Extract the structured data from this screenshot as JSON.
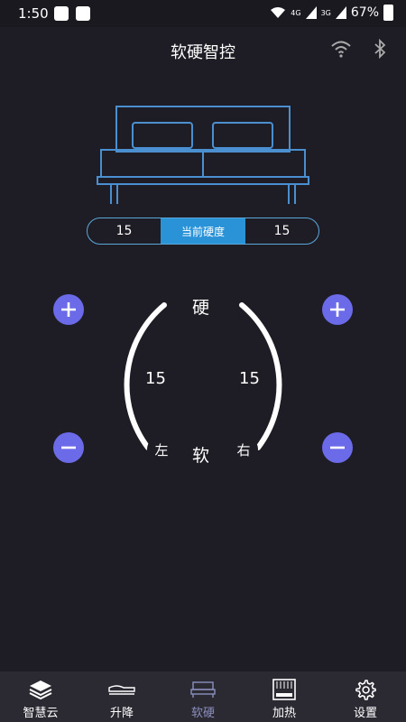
{
  "status_bar": {
    "time": "1:50",
    "battery_percent": "67%",
    "network_labels": [
      "4G",
      "3G"
    ]
  },
  "header": {
    "title": "软硬智控"
  },
  "hardness": {
    "left_value": "15",
    "label": "当前硬度",
    "right_value": "15"
  },
  "dial": {
    "top_label": "硬",
    "bottom_label": "软",
    "left_value": "15",
    "right_value": "15",
    "left_side": "左",
    "right_side": "右"
  },
  "tabs": [
    {
      "label": "智慧云",
      "icon": "layers-icon",
      "active": false
    },
    {
      "label": "升降",
      "icon": "mattress-icon",
      "active": false
    },
    {
      "label": "软硬",
      "icon": "bed-icon",
      "active": true
    },
    {
      "label": "加热",
      "icon": "heater-icon",
      "active": false
    },
    {
      "label": "设置",
      "icon": "gear-icon",
      "active": false
    }
  ],
  "colors": {
    "background": "#1e1d26",
    "accent_blue": "#2a93d8",
    "button_purple": "#6b6ae8",
    "line_blue": "#5aa7d9",
    "active_tab": "#8c8fbf"
  }
}
